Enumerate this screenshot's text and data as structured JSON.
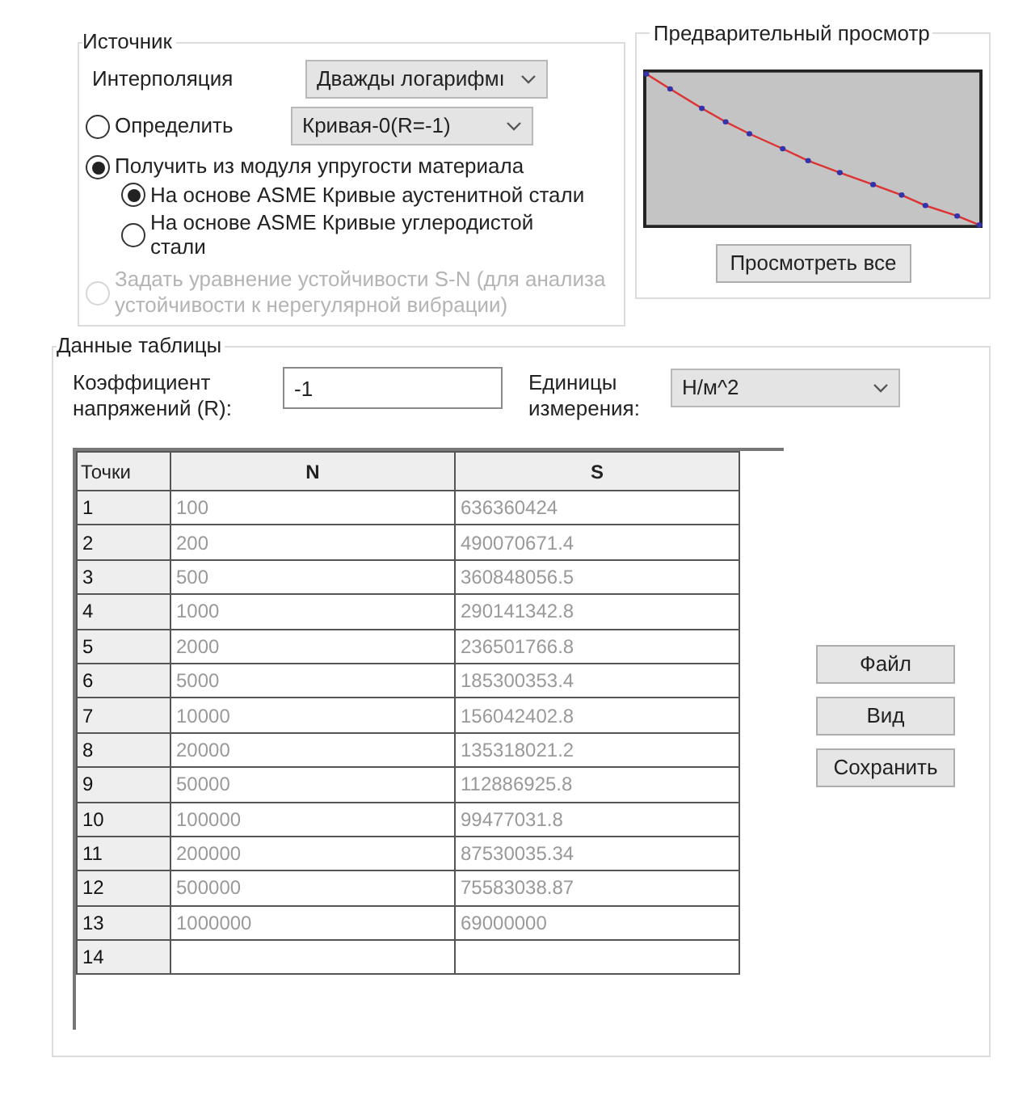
{
  "source": {
    "title": "Источник",
    "interpolation": {
      "label": "Интерполяция",
      "value": "Дважды логарифмı"
    },
    "options": [
      {
        "label": "Определить",
        "selected": false,
        "disabled": false,
        "dropdown": "Кривая-0(R=-1)"
      },
      {
        "label": "Получить из модуля упругости материала",
        "selected": true,
        "disabled": false,
        "children": [
          {
            "label": "На основе ASME Кривые аустенитной стали",
            "selected": true
          },
          {
            "label": "На основе ASME Кривые углеродистой стали",
            "selected": false
          }
        ]
      },
      {
        "label": "Задать уравнение устойчивости S-N (для анализа устойчивости к нерегулярной вибрации)",
        "selected": false,
        "disabled": true
      }
    ]
  },
  "preview": {
    "title": "Предварительный просмотр",
    "button": "Просмотреть все"
  },
  "table_data": {
    "title": "Данные таблицы",
    "ratio": {
      "label": "Коэффициент напряжений (R):",
      "value": "-1"
    },
    "units": {
      "label": "Единицы измерения:",
      "value": "Н/м^2"
    },
    "columns": [
      "Точки",
      "N",
      "S"
    ],
    "rows": [
      [
        "1",
        "100",
        "636360424"
      ],
      [
        "2",
        "200",
        "490070671.4"
      ],
      [
        "3",
        "500",
        "360848056.5"
      ],
      [
        "4",
        "1000",
        "290141342.8"
      ],
      [
        "5",
        "2000",
        "236501766.8"
      ],
      [
        "6",
        "5000",
        "185300353.4"
      ],
      [
        "7",
        "10000",
        "156042402.8"
      ],
      [
        "8",
        "20000",
        "135318021.2"
      ],
      [
        "9",
        "50000",
        "112886925.8"
      ],
      [
        "10",
        "100000",
        "99477031.8"
      ],
      [
        "11",
        "200000",
        "87530035.34"
      ],
      [
        "12",
        "500000",
        "75583038.87"
      ],
      [
        "13",
        "1000000",
        "69000000"
      ],
      [
        "14",
        "",
        ""
      ]
    ],
    "buttons": [
      "Файл",
      "Вид",
      "Сохранить"
    ]
  }
}
